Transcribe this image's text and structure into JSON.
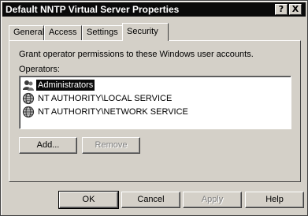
{
  "window": {
    "title": "Default NNTP Virtual Server Properties",
    "help_button": "?",
    "close_button": "X"
  },
  "tabs": [
    {
      "label": "General"
    },
    {
      "label": "Access"
    },
    {
      "label": "Settings"
    },
    {
      "label": "Security",
      "active": true
    }
  ],
  "security": {
    "description": "Grant operator permissions to these Windows user accounts.",
    "operators_label": "Operators:",
    "operators": [
      {
        "name": "Administrators",
        "icon": "group-icon",
        "selected": true
      },
      {
        "name": "NT AUTHORITY\\LOCAL SERVICE",
        "icon": "globe-icon",
        "selected": false
      },
      {
        "name": "NT AUTHORITY\\NETWORK SERVICE",
        "icon": "globe-icon",
        "selected": false
      }
    ],
    "add_button": "Add...",
    "remove_button": "Remove"
  },
  "footer": {
    "ok": "OK",
    "cancel": "Cancel",
    "apply": "Apply",
    "help": "Help"
  }
}
